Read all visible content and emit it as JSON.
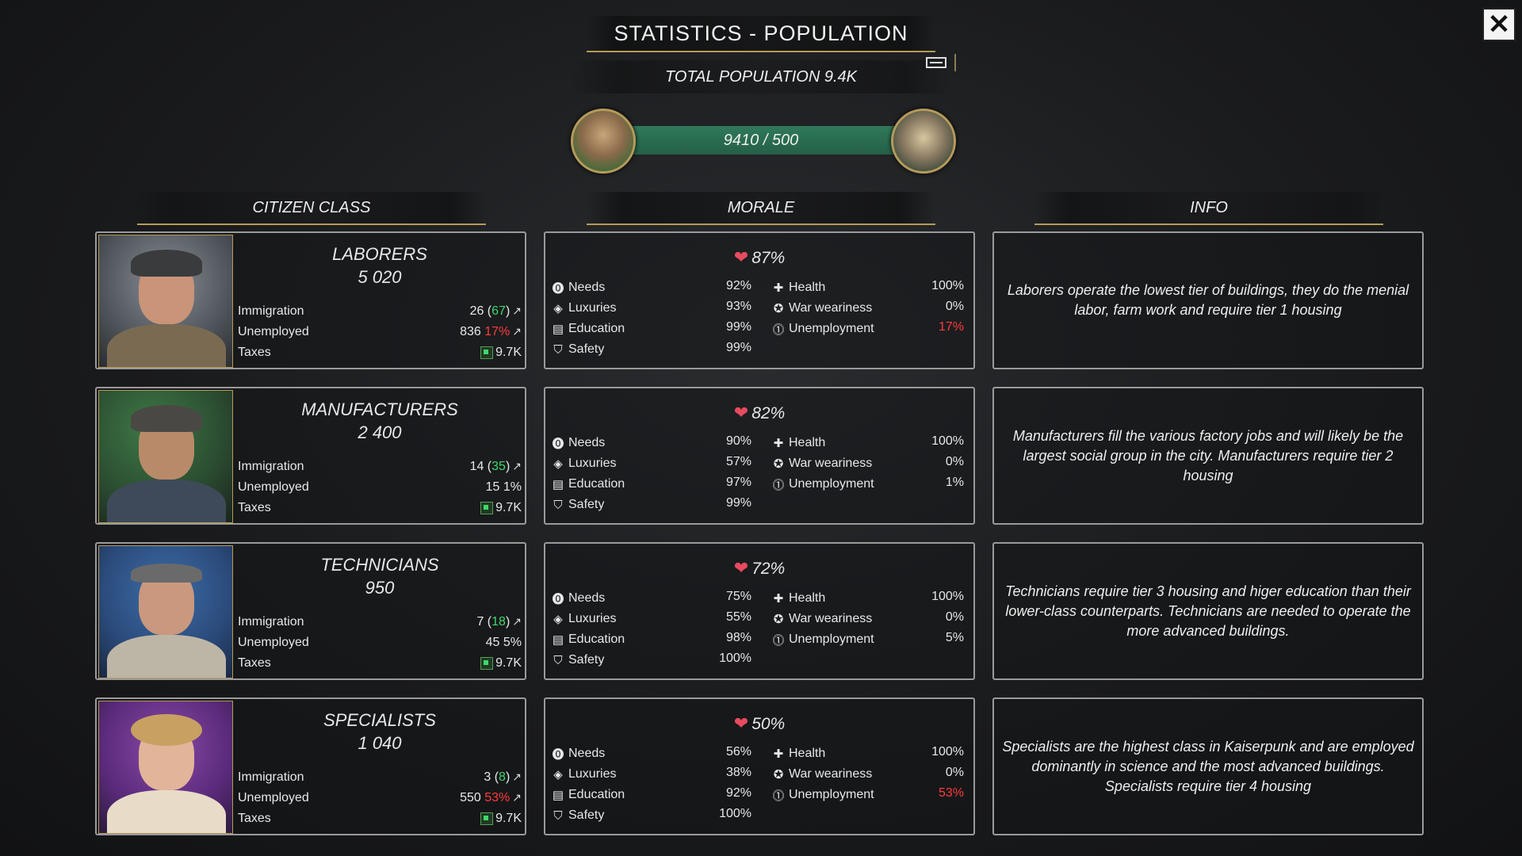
{
  "header": {
    "title": "STATISTICS - POPULATION",
    "total_population": "TOTAL POPULATION 9.4K",
    "progress_text": "9410 / 500"
  },
  "columns": {
    "citizen_class": "CITIZEN CLASS",
    "morale": "MORALE",
    "info": "INFO"
  },
  "labels": {
    "immigration": "Immigration",
    "unemployed": "Unemployed",
    "taxes": "Taxes",
    "needs": "Needs",
    "luxuries": "Luxuries",
    "education": "Education",
    "safety": "Safety",
    "health": "Health",
    "war_weariness": "War weariness",
    "unemployment": "Unemployment"
  },
  "icons": {
    "close": "close-icon",
    "needs": "needs-icon",
    "luxuries": "diamond-icon",
    "education": "book-icon",
    "safety": "shield-icon",
    "health": "plus-icon",
    "war_weariness": "war-icon",
    "unemployment": "unemployment-icon",
    "morale": "heart-icon",
    "immigration_trend": "arrow-up-icon",
    "tax": "money-icon"
  },
  "colors": {
    "accent_gold": "#b59a5a",
    "progress_green": "#2f7a5a",
    "positive": "#3fd86a",
    "negative": "#ff3b3b"
  },
  "classes": [
    {
      "name": "LABORERS",
      "count": "5 020",
      "immigration_base": "26",
      "immigration_extra": "67",
      "unemployed_count": "836",
      "unemployed_pct": "17%",
      "unemployed_red": true,
      "unemployed_arrow": true,
      "taxes": "9.7K",
      "morale": "87%",
      "needs": "92%",
      "luxuries": "93%",
      "education": "99%",
      "safety": "99%",
      "health": "100%",
      "war_weariness": "0%",
      "unemployment": "17%",
      "unemployment_red": true,
      "info": "Laborers operate the lowest tier of buildings, they do the menial labor, farm work and require tier 1 housing"
    },
    {
      "name": "MANUFACTURERS",
      "count": "2 400",
      "immigration_base": "14",
      "immigration_extra": "35",
      "unemployed_count": "15",
      "unemployed_pct": "1%",
      "unemployed_red": false,
      "unemployed_arrow": false,
      "taxes": "9.7K",
      "morale": "82%",
      "needs": "90%",
      "luxuries": "57%",
      "education": "97%",
      "safety": "99%",
      "health": "100%",
      "war_weariness": "0%",
      "unemployment": "1%",
      "unemployment_red": false,
      "info": "Manufacturers fill the various factory jobs and will likely be the largest social group in the city. Manufacturers require tier 2 housing"
    },
    {
      "name": "TECHNICIANS",
      "count": "950",
      "immigration_base": "7",
      "immigration_extra": "18",
      "unemployed_count": "45",
      "unemployed_pct": "5%",
      "unemployed_red": false,
      "unemployed_arrow": false,
      "taxes": "9.7K",
      "morale": "72%",
      "needs": "75%",
      "luxuries": "55%",
      "education": "98%",
      "safety": "100%",
      "health": "100%",
      "war_weariness": "0%",
      "unemployment": "5%",
      "unemployment_red": false,
      "info": "Technicians require tier 3 housing and higer education than their lower-class counterparts. Technicians are needed to operate the more advanced buildings."
    },
    {
      "name": "SPECIALISTS",
      "count": "1 040",
      "immigration_base": "3",
      "immigration_extra": "8",
      "unemployed_count": "550",
      "unemployed_pct": "53%",
      "unemployed_red": true,
      "unemployed_arrow": true,
      "taxes": "9.7K",
      "morale": "50%",
      "needs": "56%",
      "luxuries": "38%",
      "education": "92%",
      "safety": "100%",
      "health": "100%",
      "war_weariness": "0%",
      "unemployment": "53%",
      "unemployment_red": true,
      "info": "Specialists are the highest class in Kaiserpunk and are employed dominantly in science and the most advanced buildings. Specialists require tier 4 housing"
    }
  ]
}
